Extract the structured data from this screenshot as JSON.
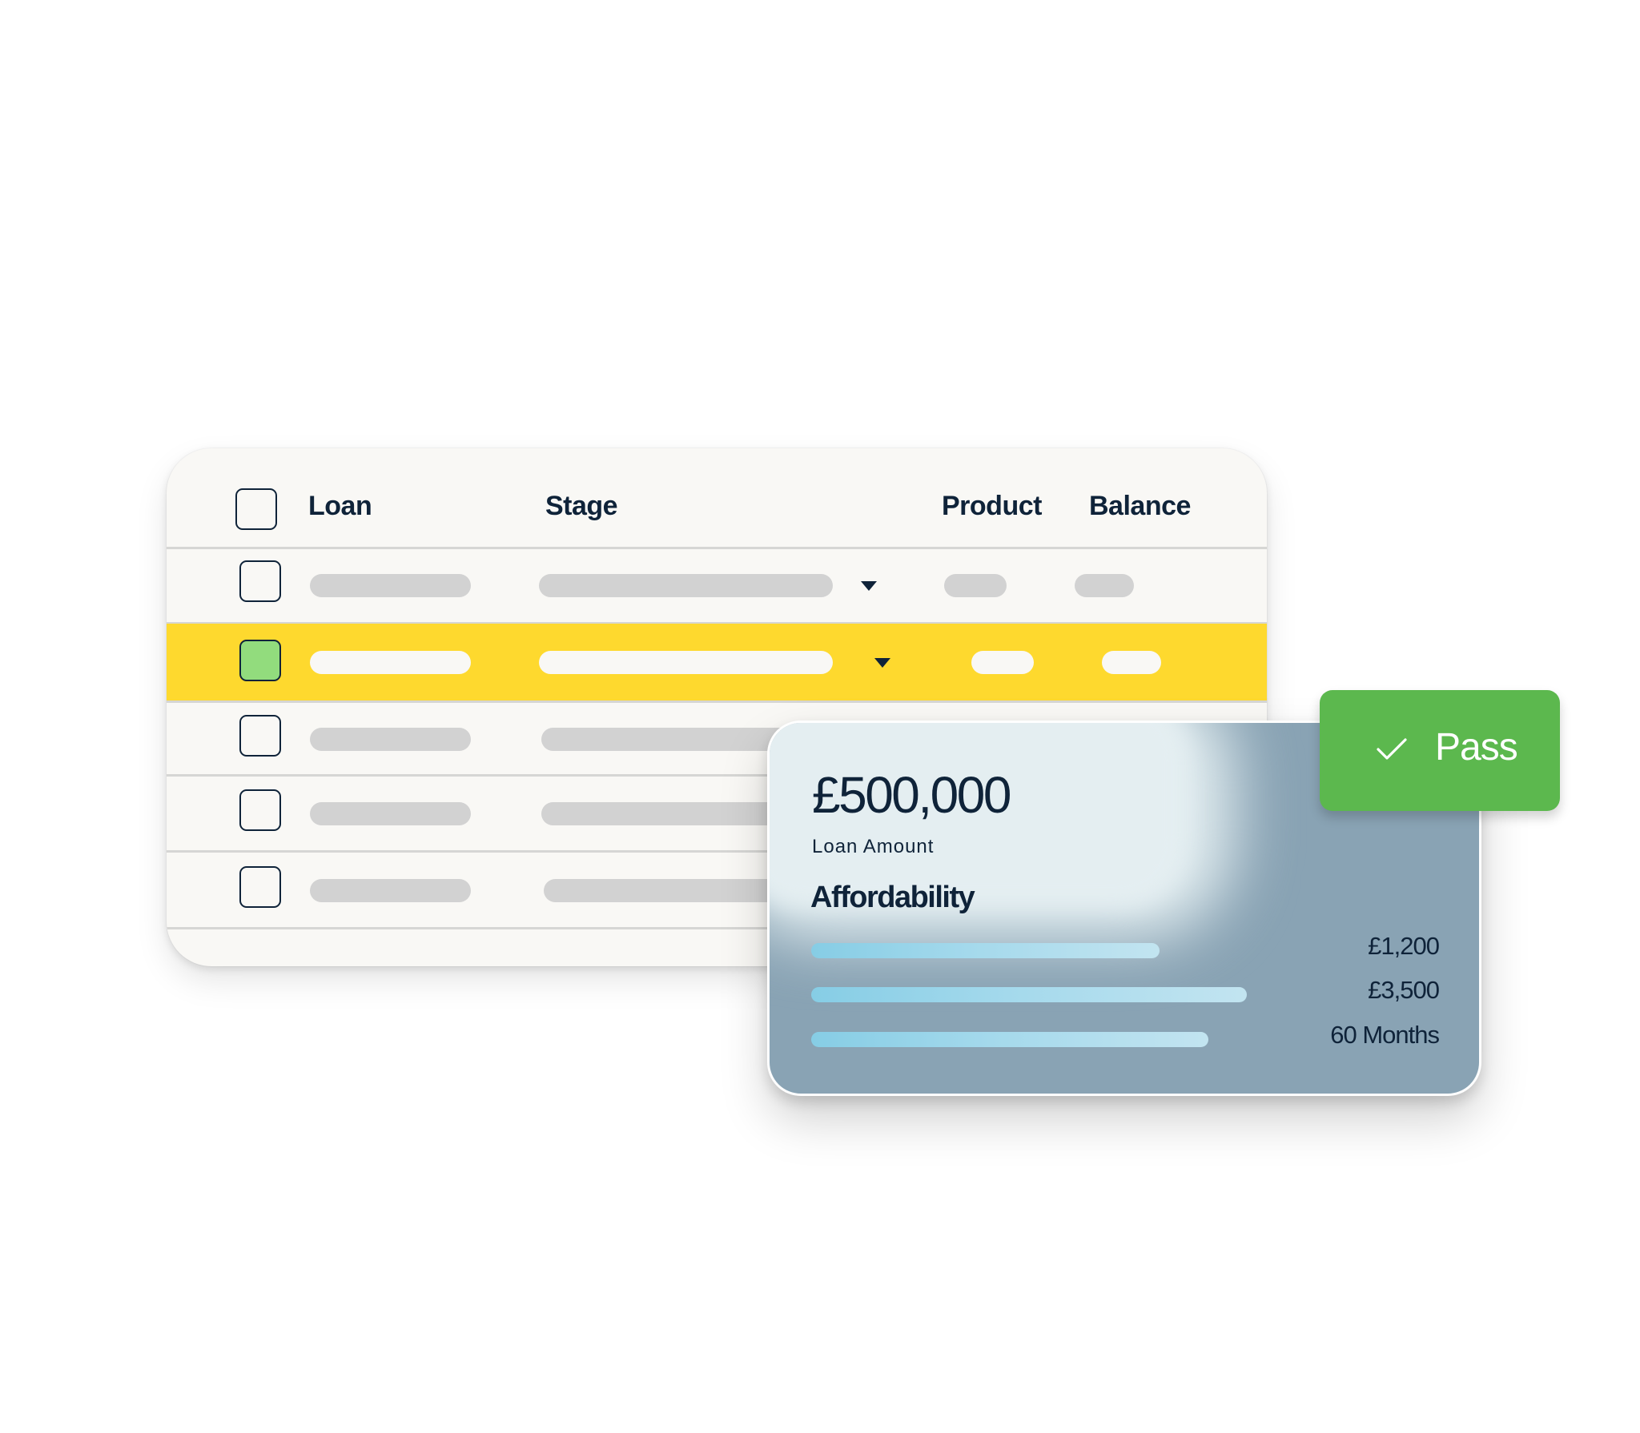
{
  "table": {
    "headers": {
      "loan": "Loan",
      "stage": "Stage",
      "product": "Product",
      "balance": "Balance"
    },
    "select_all_checked": false,
    "rows": [
      {
        "checked": false,
        "highlighted": false,
        "stage_dropdown": true
      },
      {
        "checked": true,
        "highlighted": true,
        "stage_dropdown": true
      },
      {
        "checked": false,
        "highlighted": false
      },
      {
        "checked": false,
        "highlighted": false
      },
      {
        "checked": false,
        "highlighted": false
      }
    ],
    "colors": {
      "highlight": "#fed92e",
      "checked_box": "#92dc7d",
      "placeholder": "#d2d2d2",
      "text": "#0f2339"
    }
  },
  "affordability_card": {
    "amount": "£500,000",
    "amount_label": "Loan Amount",
    "title": "Affordability",
    "items": [
      {
        "value": "£1,200",
        "fill_fraction": 0.64
      },
      {
        "value": "£3,500",
        "fill_fraction": 0.8
      },
      {
        "value": "60 Months",
        "fill_fraction": 0.73
      }
    ],
    "colors": {
      "background": "#89a3b4",
      "highlight": "#e2edf0",
      "bar": "#86cde5"
    }
  },
  "status_badge": {
    "icon": "check-icon",
    "label": "Pass",
    "color": "#5cb84e"
  }
}
